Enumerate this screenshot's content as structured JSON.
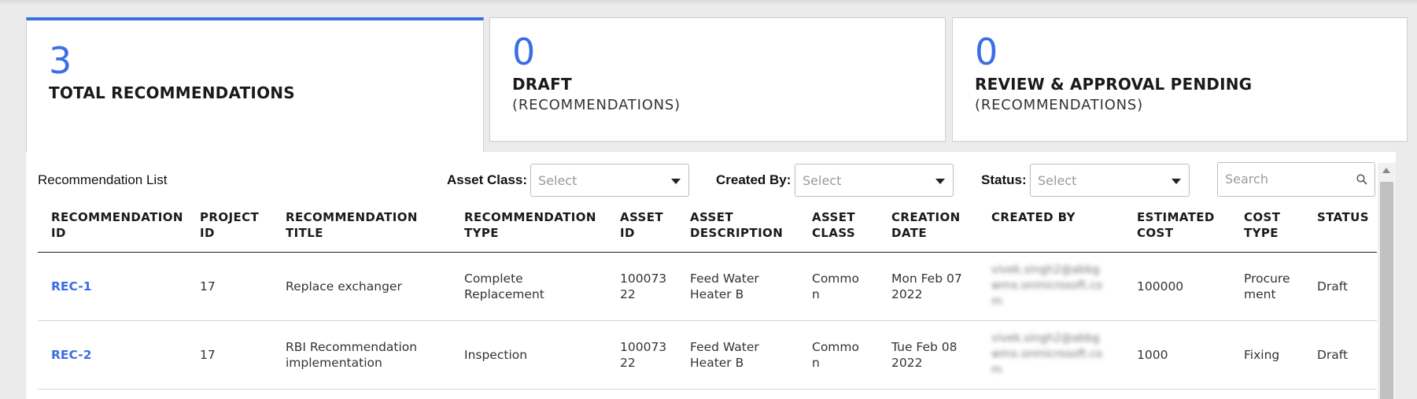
{
  "cards": [
    {
      "value": "3",
      "title": "TOTAL RECOMMENDATIONS",
      "subtitle": ""
    },
    {
      "value": "0",
      "title": "DRAFT",
      "subtitle": "(RECOMMENDATIONS)"
    },
    {
      "value": "0",
      "title": "REVIEW & APPROVAL PENDING",
      "subtitle": "(RECOMMENDATIONS)"
    }
  ],
  "list": {
    "title": "Recommendation List",
    "filters": {
      "asset_class": {
        "label": "Asset Class:",
        "placeholder": "Select"
      },
      "created_by": {
        "label": "Created By:",
        "placeholder": "Select"
      },
      "status": {
        "label": "Status:",
        "placeholder": "Select"
      }
    },
    "search": {
      "placeholder": "Search"
    }
  },
  "table": {
    "headers": {
      "rec_id": [
        "RECOMMENDATION",
        "ID"
      ],
      "project_id": [
        "PROJECT",
        "ID"
      ],
      "title": [
        "RECOMMENDATION",
        "TITLE"
      ],
      "type": [
        "RECOMMENDATION",
        "TYPE"
      ],
      "asset_id": [
        "ASSET",
        "ID"
      ],
      "asset_desc": [
        "ASSET",
        "DESCRIPTION"
      ],
      "asset_class": [
        "ASSET",
        "CLASS"
      ],
      "creation_date": [
        "CREATION",
        "DATE"
      ],
      "created_by": [
        "CREATED BY"
      ],
      "est_cost": [
        "ESTIMATED",
        "COST"
      ],
      "cost_type": [
        "COST",
        "TYPE"
      ],
      "status": [
        "STATUS"
      ]
    },
    "rows": [
      {
        "rec_id": "REC-1",
        "project_id": "17",
        "title": "Replace exchanger",
        "type": [
          "Complete",
          "Replacement"
        ],
        "asset_id": [
          "100073",
          "22"
        ],
        "asset_desc": [
          "Feed Water",
          "Heater B"
        ],
        "asset_class": [
          "Commo",
          "n"
        ],
        "creation_date": [
          "Mon Feb 07",
          "2022"
        ],
        "created_by": [
          "vivek.singh2@abbg",
          "wmx.onmicrosoft.co",
          "m"
        ],
        "est_cost": "100000",
        "cost_type": [
          "Procure",
          "ment"
        ],
        "status": "Draft"
      },
      {
        "rec_id": "REC-2",
        "project_id": "17",
        "title": [
          "RBI Recommendation",
          "implementation"
        ],
        "type": "Inspection",
        "asset_id": [
          "100073",
          "22"
        ],
        "asset_desc": [
          "Feed Water",
          "Heater B"
        ],
        "asset_class": [
          "Commo",
          "n"
        ],
        "creation_date": [
          "Tue Feb 08",
          "2022"
        ],
        "created_by": [
          "vivek.singh2@abbg",
          "wmx.onmicrosoft.co",
          "m"
        ],
        "est_cost": "1000",
        "cost_type": "Fixing",
        "status": "Draft"
      }
    ]
  },
  "colors": {
    "accent": "#3a6ee8"
  }
}
